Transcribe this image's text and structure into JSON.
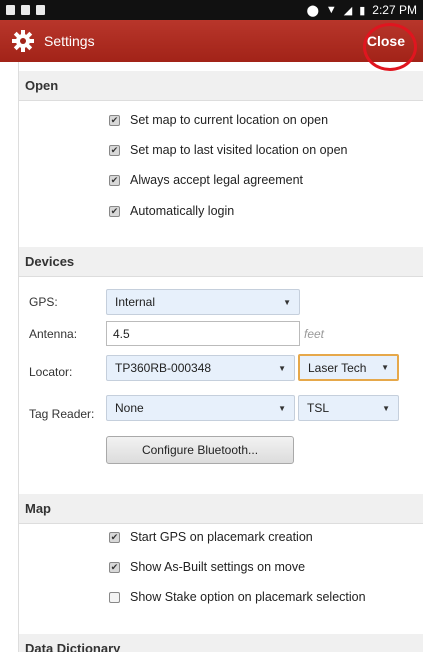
{
  "status_bar": {
    "time": "2:27 PM"
  },
  "app_bar": {
    "title": "Settings",
    "close_label": "Close"
  },
  "sections": {
    "open": {
      "title": "Open",
      "items": [
        {
          "label": "Set map to current location on open",
          "checked": true
        },
        {
          "label": "Set map to last visited location on open",
          "checked": true
        },
        {
          "label": "Always accept legal agreement",
          "checked": true
        },
        {
          "label": "Automatically login",
          "checked": true
        }
      ]
    },
    "devices": {
      "title": "Devices",
      "gps_label": "GPS:",
      "gps_value": "Internal",
      "antenna_label": "Antenna:",
      "antenna_value": "4.5",
      "antenna_unit": "feet",
      "locator_label": "Locator:",
      "locator_value": "TP360RB-000348",
      "locator_brand": "Laser Tech",
      "tag_label": "Tag Reader:",
      "tag_value": "None",
      "tag_brand": "TSL",
      "bluetooth_button": "Configure Bluetooth..."
    },
    "map": {
      "title": "Map",
      "items": [
        {
          "label": "Start GPS on placemark creation",
          "checked": true
        },
        {
          "label": "Show As-Built settings on move",
          "checked": true
        },
        {
          "label": "Show Stake option on placemark selection",
          "checked": false
        }
      ]
    },
    "data_dictionary": {
      "title": "Data Dictionary"
    }
  },
  "colors": {
    "app_bar": "#a22318",
    "highlight": "#e0151f",
    "select_bg": "#e7f0fb"
  }
}
